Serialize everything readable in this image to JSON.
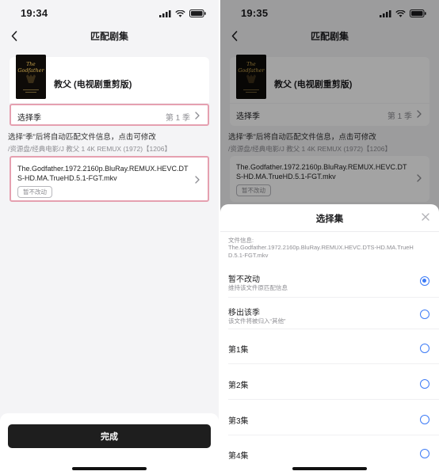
{
  "colors": {
    "accent": "#3d7bf6",
    "highlight": "#e5a0b0",
    "button": "#1e1e1e"
  },
  "left": {
    "status": {
      "time": "19:34"
    },
    "nav": {
      "title": "匹配剧集"
    },
    "movie": {
      "title": "教父 (电视剧重剪版)"
    },
    "season": {
      "label": "选择季",
      "value": "第 1 季"
    },
    "hint": "选择“季”后将自动匹配文件信息，点击可修改",
    "path": "/资源盘/经典电影/J 教父 1 4K REMUX (1972)【1206】",
    "file": {
      "name": "The.Godfather.1972.2160p.BluRay.REMUX.HEVC.DTS-HD.MA.TrueHD.5.1-FGT.mkv",
      "tag": "暂不改动"
    },
    "done_label": "完成"
  },
  "right": {
    "status": {
      "time": "19:35"
    },
    "nav": {
      "title": "匹配剧集"
    },
    "movie": {
      "title": "教父 (电视剧重剪版)"
    },
    "season": {
      "label": "选择季",
      "value": "第 1 季"
    },
    "hint": "选择“季”后将自动匹配文件信息，点击可修改",
    "path": "/资源盘/经典电影/J 教父 1 4K REMUX (1972)【1206】",
    "file": {
      "name": "The.Godfather.1972.2160p.BluRay.REMUX.HEVC.DTS-HD.MA.TrueHD.5.1-FGT.mkv",
      "tag": "暂不改动"
    },
    "sheet": {
      "title": "选择集",
      "file_info_label": "文件信息:",
      "file_info_value": "The.Godfather.1972.2160p.BluRay.REMUX.HEVC.DTS-HD.MA.TrueHD.5.1-FGT.mkv",
      "options": [
        {
          "title": "暂不改动",
          "subtitle": "维持该文件原匹配信息",
          "selected": true
        },
        {
          "title": "移出该季",
          "subtitle": "该文件将被归入“其他”",
          "selected": false
        },
        {
          "title": "第1集",
          "subtitle": "",
          "selected": false
        },
        {
          "title": "第2集",
          "subtitle": "",
          "selected": false
        },
        {
          "title": "第3集",
          "subtitle": "",
          "selected": false
        },
        {
          "title": "第4集",
          "subtitle": "",
          "selected": false
        }
      ]
    }
  }
}
